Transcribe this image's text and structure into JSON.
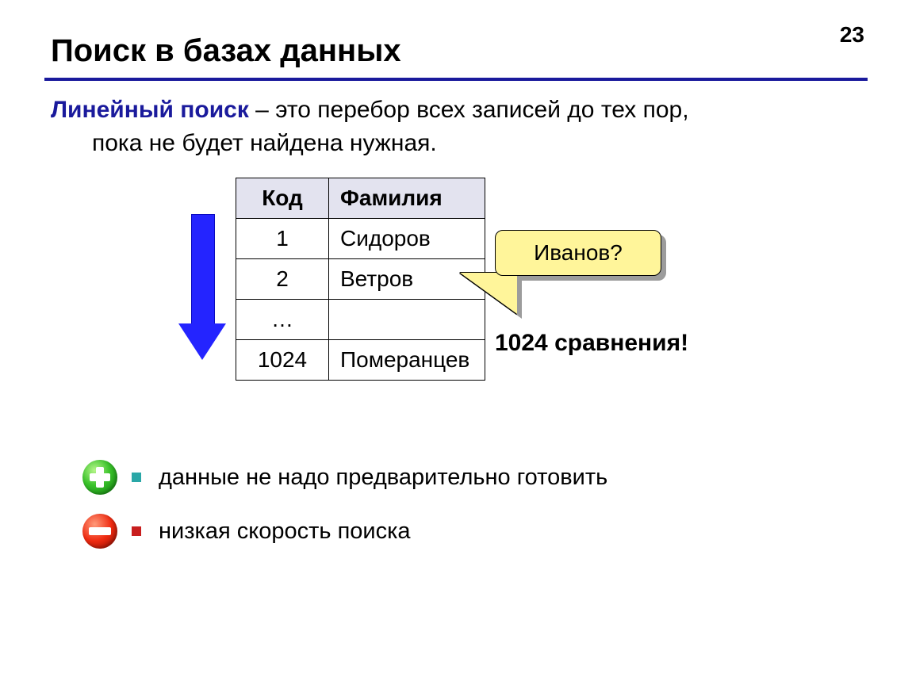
{
  "page_number": "23",
  "title": "Поиск в базах данных",
  "definition": {
    "term": "Линейный поиск",
    "rest_line1": " – это перебор всех записей до тех пор,",
    "line2": "пока не будет найдена нужная."
  },
  "table": {
    "headers": {
      "code": "Код",
      "name": "Фамилия"
    },
    "rows": [
      {
        "code": "1",
        "name": "Сидоров"
      },
      {
        "code": "2",
        "name": "Ветров"
      },
      {
        "code": "…",
        "name": ""
      },
      {
        "code": "1024",
        "name": "Померанцев"
      }
    ]
  },
  "callout_text": "Иванов?",
  "comparisons_text": "1024 сравнения!",
  "pros_cons": {
    "plus": "данные не надо предварительно готовить",
    "minus": "низкая скорость поиска"
  }
}
